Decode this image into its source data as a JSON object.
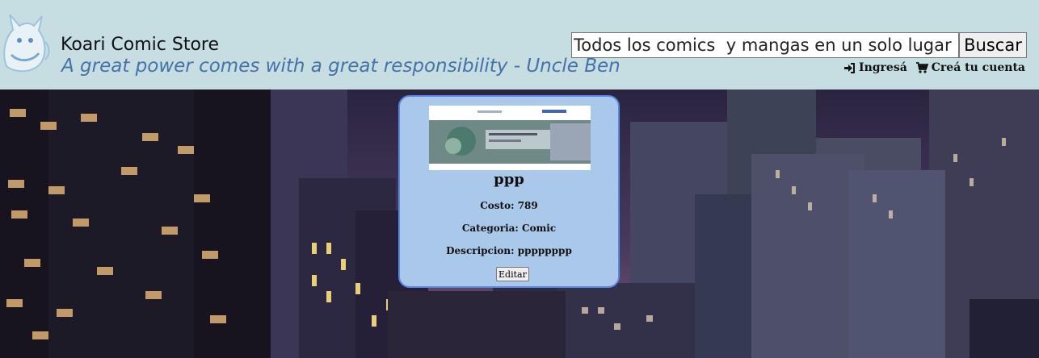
{
  "header": {
    "title": "Koari Comic Store",
    "quote": "A great power comes with a great responsibility - Uncle Ben",
    "search_placeholder": "Todos los comics  y mangas en un solo lugar",
    "search_button": "Buscar",
    "login_label": "Ingresá",
    "login_icon": "sign-in-icon",
    "register_label": "Creá tu cuenta",
    "register_icon": "cart-icon"
  },
  "product": {
    "name": "ppp",
    "cost": "Costo: 789",
    "category": "Categoria: Comic",
    "description": "Descripcion: pppppppp",
    "edit_button": "Editar"
  },
  "colors": {
    "header_bg": "#c6dde2",
    "quote": "#4672a8",
    "card_bg": "#a9c8ea",
    "card_border": "#5a86e6"
  }
}
